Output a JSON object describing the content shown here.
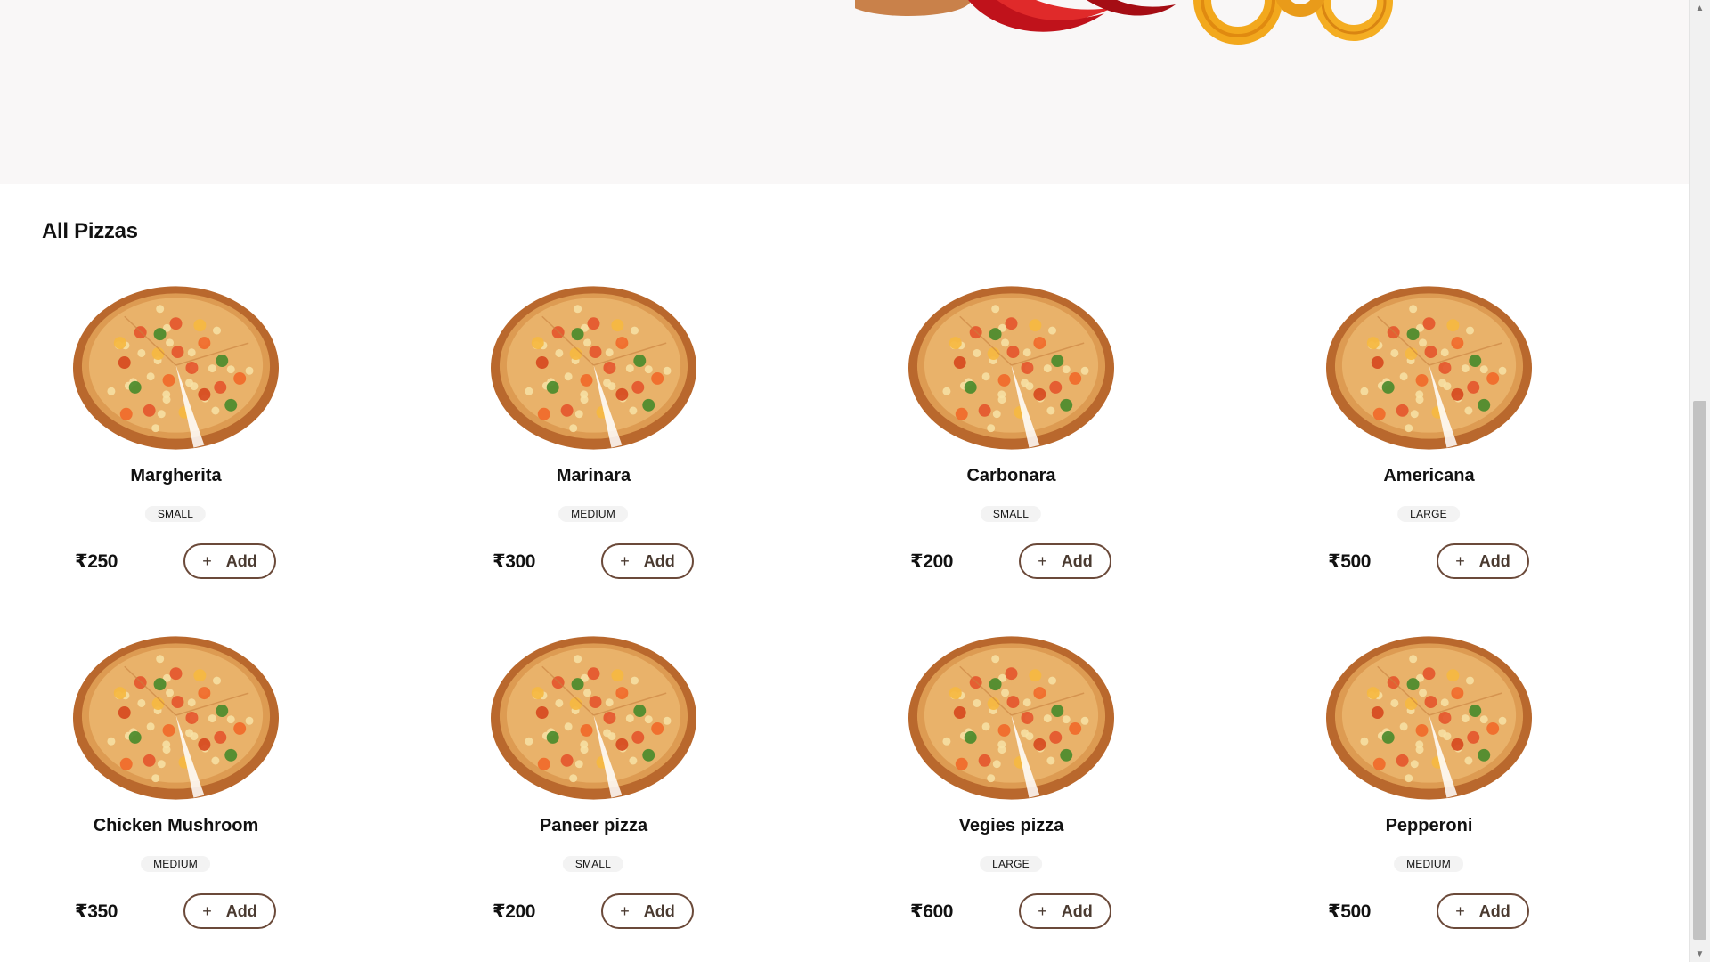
{
  "section": {
    "title": "All Pizzas"
  },
  "currency_symbol": "₹",
  "add_label": "Add",
  "plus_symbol": "+",
  "pizzas": [
    {
      "name": "Margherita",
      "size": "SMALL",
      "price": "₹250"
    },
    {
      "name": "Marinara",
      "size": "MEDIUM",
      "price": "₹300"
    },
    {
      "name": "Carbonara",
      "size": "SMALL",
      "price": "₹200"
    },
    {
      "name": "Americana",
      "size": "LARGE",
      "price": "₹500"
    },
    {
      "name": "Chicken Mushroom",
      "size": "MEDIUM",
      "price": "₹350"
    },
    {
      "name": "Paneer pizza",
      "size": "SMALL",
      "price": "₹200"
    },
    {
      "name": "Vegies pizza",
      "size": "LARGE",
      "price": "₹600"
    },
    {
      "name": "Pepperoni",
      "size": "MEDIUM",
      "price": "₹500"
    }
  ],
  "icons": {
    "scroll_up": "scroll-up-arrow-icon",
    "scroll_down": "scroll-down-arrow-icon",
    "plus": "plus-icon"
  }
}
